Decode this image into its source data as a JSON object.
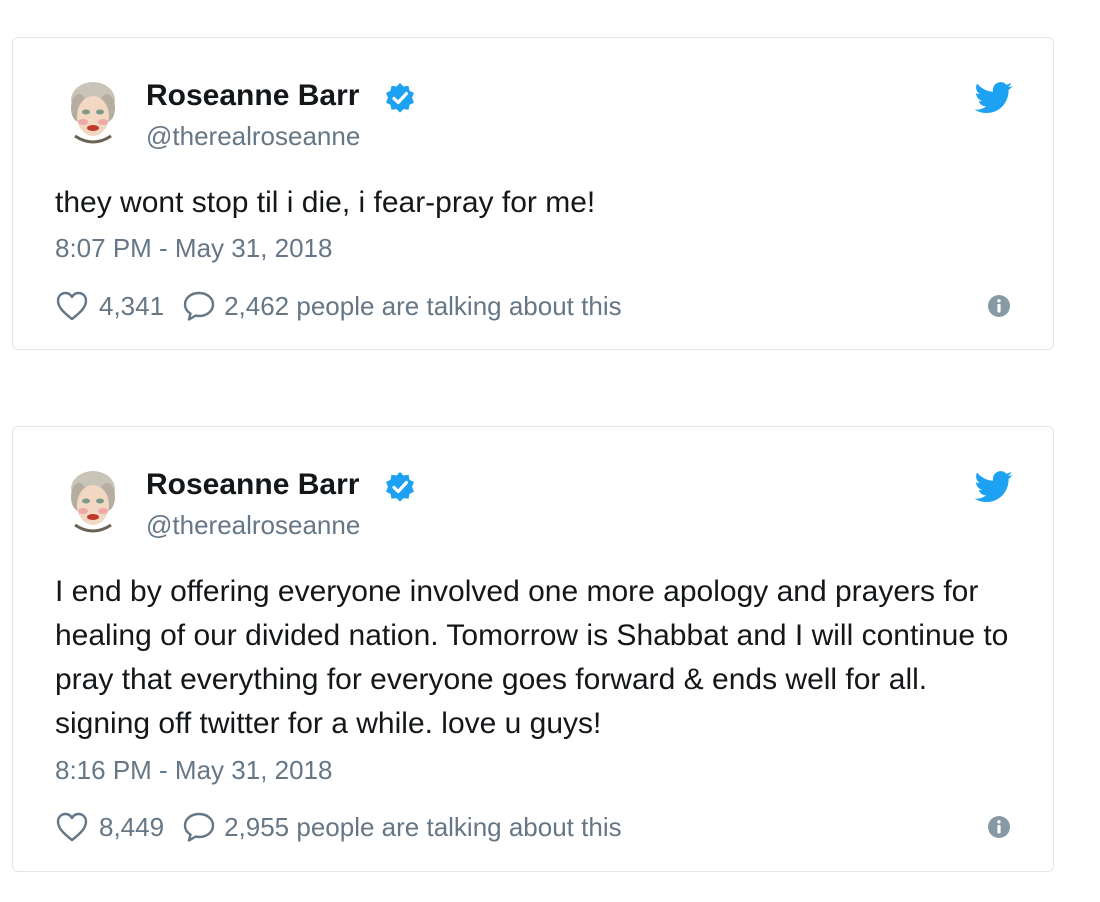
{
  "colors": {
    "text": "#14171a",
    "secondary_text": "#657786",
    "verified_blue": "#1da1f2",
    "twitter_blue": "#1da1f2",
    "card_border": "#e1e8ed"
  },
  "icons": {
    "verified": "verified-badge-icon",
    "twitter": "twitter-bird-icon",
    "like": "heart-icon",
    "reply": "speech-bubble-icon",
    "info": "info-circle-icon"
  },
  "tweets": [
    {
      "author_name": "Roseanne Barr",
      "author_handle": "@therealroseanne",
      "text": "they wont stop til i die, i fear-pray for me!",
      "timestamp": "8:07 PM - May 31, 2018",
      "likes": "4,341",
      "talking": "2,462 people are talking about this"
    },
    {
      "author_name": "Roseanne Barr",
      "author_handle": "@therealroseanne",
      "text": "I end by offering everyone involved one more apology and prayers for healing of our divided nation. Tomorrow is Shabbat and I will continue to pray that everything for everyone goes forward & ends well for all. signing off twitter for a while. love u guys!",
      "timestamp": "8:16 PM - May 31, 2018",
      "likes": "8,449",
      "talking": "2,955 people are talking about this"
    }
  ]
}
